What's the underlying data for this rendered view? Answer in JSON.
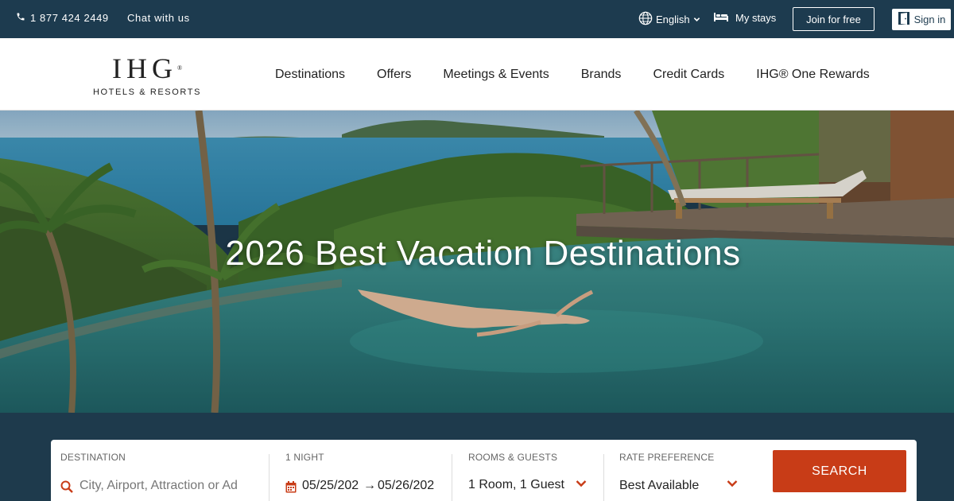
{
  "topbar": {
    "phone": "1 877 424 2449",
    "chat": "Chat with us",
    "language": "English",
    "my_stays": "My stays",
    "join": "Join for free",
    "sign_in": "Sign in"
  },
  "brand": {
    "mark": "IHG",
    "registered": "®",
    "subtitle": "HOTELS & RESORTS"
  },
  "nav": {
    "items": [
      "Destinations",
      "Offers",
      "Meetings & Events",
      "Brands",
      "Credit Cards",
      "IHG® One Rewards"
    ]
  },
  "hero": {
    "title": "2026 Best Vacation Destinations"
  },
  "search": {
    "destination_label": "DESTINATION",
    "destination_placeholder": "City, Airport, Attraction or Ad",
    "nights_label": "1 NIGHT",
    "checkin": "05/25/202",
    "checkout": "05/26/202",
    "arrow": "→",
    "rooms_label": "ROOMS & GUESTS",
    "rooms_value": "1 Room, 1 Guest",
    "rate_label": "RATE PREFERENCE",
    "rate_value": "Best Available",
    "button": "SEARCH"
  },
  "colors": {
    "topbar": "#1d3b4f",
    "accent": "#c83c17"
  }
}
